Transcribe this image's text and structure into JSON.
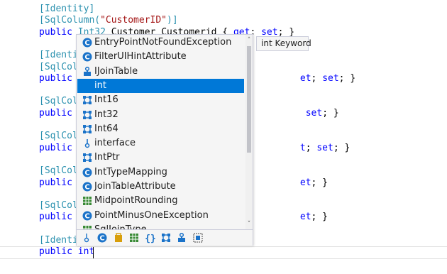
{
  "editor": {
    "lines": [
      {
        "parts": [
          {
            "t": "[Identity]",
            "c": "ty"
          }
        ]
      },
      {
        "parts": [
          {
            "t": "[SqlColumn(",
            "c": "ty"
          },
          {
            "t": "\"CustomerID\"",
            "c": "st"
          },
          {
            "t": ")]",
            "c": "ty"
          }
        ]
      },
      {
        "parts": [
          {
            "t": "public ",
            "c": "kw"
          },
          {
            "t": "Int32",
            "c": "ty"
          },
          {
            "t": " Customer Customerid { ",
            "c": ""
          },
          {
            "t": "get",
            "c": "kw"
          },
          {
            "t": "; ",
            "c": ""
          },
          {
            "t": "set",
            "c": "kw"
          },
          {
            "t": "; }",
            "c": ""
          }
        ]
      },
      {
        "parts": []
      },
      {
        "parts": [
          {
            "t": "[Identi",
            "c": "ty"
          }
        ]
      },
      {
        "parts": [
          {
            "t": "[SqlCol",
            "c": "ty"
          }
        ]
      },
      {
        "parts": [
          {
            "t": "public ",
            "c": "kw"
          },
          {
            "t": "                                        ",
            "c": ""
          },
          {
            "t": "et",
            "c": "kw"
          },
          {
            "t": "; ",
            "c": ""
          },
          {
            "t": "set",
            "c": "kw"
          },
          {
            "t": "; }",
            "c": ""
          }
        ]
      },
      {
        "parts": []
      },
      {
        "parts": [
          {
            "t": "[SqlCol",
            "c": "ty"
          }
        ]
      },
      {
        "parts": [
          {
            "t": "public ",
            "c": "kw"
          },
          {
            "t": "                                        ",
            "c": ""
          },
          {
            "t": " set",
            "c": "kw"
          },
          {
            "t": "; }",
            "c": ""
          }
        ]
      },
      {
        "parts": []
      },
      {
        "parts": [
          {
            "t": "[SqlCol",
            "c": "ty"
          }
        ]
      },
      {
        "parts": [
          {
            "t": "public ",
            "c": "kw"
          },
          {
            "t": "                                        ",
            "c": ""
          },
          {
            "t": "t",
            "c": "kw"
          },
          {
            "t": "; ",
            "c": ""
          },
          {
            "t": "set",
            "c": "kw"
          },
          {
            "t": "; }",
            "c": ""
          }
        ]
      },
      {
        "parts": []
      },
      {
        "parts": [
          {
            "t": "[SqlCol",
            "c": "ty"
          }
        ]
      },
      {
        "parts": [
          {
            "t": "public ",
            "c": "kw"
          },
          {
            "t": "                                        ",
            "c": ""
          },
          {
            "t": "et",
            "c": "kw"
          },
          {
            "t": "; }",
            "c": ""
          }
        ]
      },
      {
        "parts": []
      },
      {
        "parts": [
          {
            "t": "[SqlCol",
            "c": "ty"
          }
        ]
      },
      {
        "parts": [
          {
            "t": "public ",
            "c": "kw"
          },
          {
            "t": "                                        ",
            "c": ""
          },
          {
            "t": "et",
            "c": "kw"
          },
          {
            "t": "; }",
            "c": ""
          }
        ]
      },
      {
        "parts": []
      },
      {
        "parts": [
          {
            "t": "[Identi",
            "c": "ty"
          }
        ]
      },
      {
        "parts": [
          {
            "t": "public ",
            "c": "kw"
          },
          {
            "t": "int",
            "c": "kw"
          }
        ]
      }
    ]
  },
  "completion": {
    "items": [
      {
        "label": "EntryPointNotFoundException",
        "icon": "class-icon",
        "selected": false
      },
      {
        "label": "FilterUIHintAttribute",
        "icon": "class-icon",
        "selected": false
      },
      {
        "label": "IJoinTable",
        "icon": "interface-icon",
        "selected": false
      },
      {
        "label": "int",
        "icon": "keyword-icon",
        "selected": true
      },
      {
        "label": "Int16",
        "icon": "struct-icon",
        "selected": false
      },
      {
        "label": "Int32",
        "icon": "struct-icon",
        "selected": false
      },
      {
        "label": "Int64",
        "icon": "struct-icon",
        "selected": false
      },
      {
        "label": "interface",
        "icon": "keyword-interface-icon",
        "selected": false
      },
      {
        "label": "IntPtr",
        "icon": "struct-icon",
        "selected": false
      },
      {
        "label": "IntTypeMapping",
        "icon": "class-icon",
        "selected": false
      },
      {
        "label": "JoinTableAttribute",
        "icon": "class-icon",
        "selected": false
      },
      {
        "label": "MidpointRounding",
        "icon": "enum-icon",
        "selected": false
      },
      {
        "label": "PointMinusOneException",
        "icon": "class-icon",
        "selected": false
      },
      {
        "label": "SqlJoinType",
        "icon": "enum-icon",
        "selected": false
      }
    ],
    "filters": [
      "keyword-filter-icon",
      "class-filter-icon",
      "delegate-filter-icon",
      "enum-filter-icon",
      "namespace-filter-icon",
      "struct-filter-icon",
      "interface-filter-icon",
      "snippet-filter-icon"
    ],
    "colors": {
      "selected": "#0078d7",
      "class": "#1b73c9",
      "struct": "#1b73c9",
      "enum": "#388a34",
      "interface": "#1b73c9"
    }
  },
  "tooltip": {
    "text": "int Keyword"
  }
}
